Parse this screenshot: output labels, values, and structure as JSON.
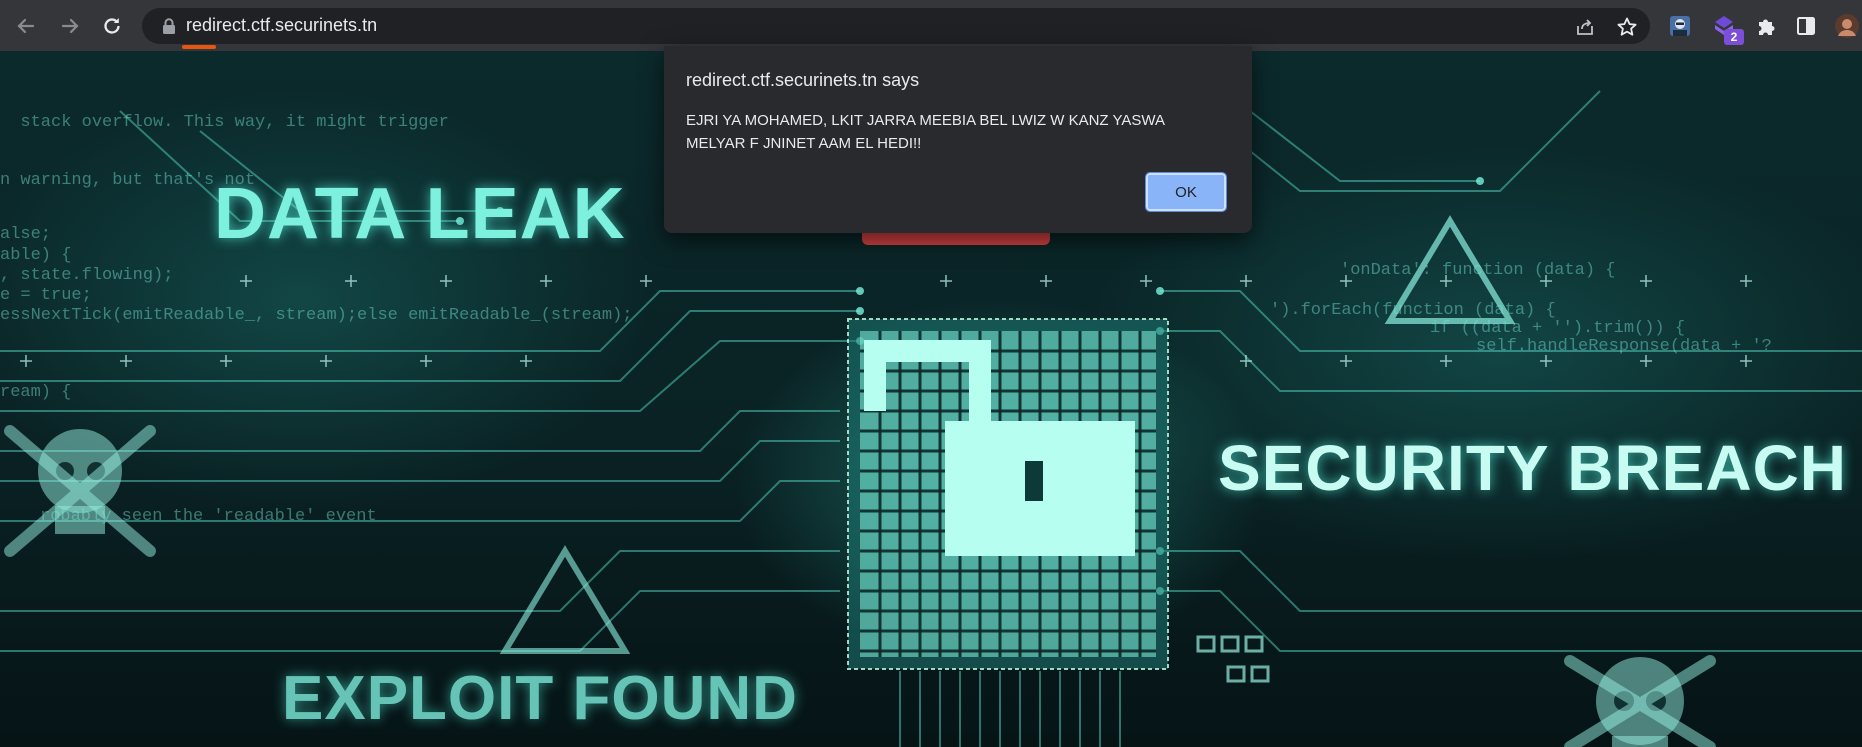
{
  "browser": {
    "url": "redirect.ctf.securinets.tn",
    "extension_badge": "2"
  },
  "page": {
    "headline_left": "DATA LEAK",
    "headline_right": "SECURITY BREACH",
    "headline_bottom": "EXPLOIT FOUND",
    "code_lines": [
      "  stack overflow. This way, it might trigger",
      "n warning, but that's not",
      "alse;",
      "able) {",
      ", state.flowing);",
      "e = true;",
      "essNextTick(emitReadable_, stream);else emitReadable_(stream);",
      "ream) {",
      "robably seen the 'readable' event",
      "'onData': function (data) {",
      "').forEach(function (data) {",
      "if ((data + '').trim()) {",
      "self.handleResponse(data + '?"
    ]
  },
  "dialog": {
    "title": "redirect.ctf.securinets.tn says",
    "message": "EJRI YA MOHAMED, LKIT JARRA MEEBIA BEL LWIZ W KANZ YASWA MELYAR F JNINET AAM EL HEDI!!",
    "ok_label": "OK"
  },
  "colors": {
    "accent": "#8ab4f8",
    "url_underline": "#e8550f",
    "glow": "#7ef0de"
  }
}
